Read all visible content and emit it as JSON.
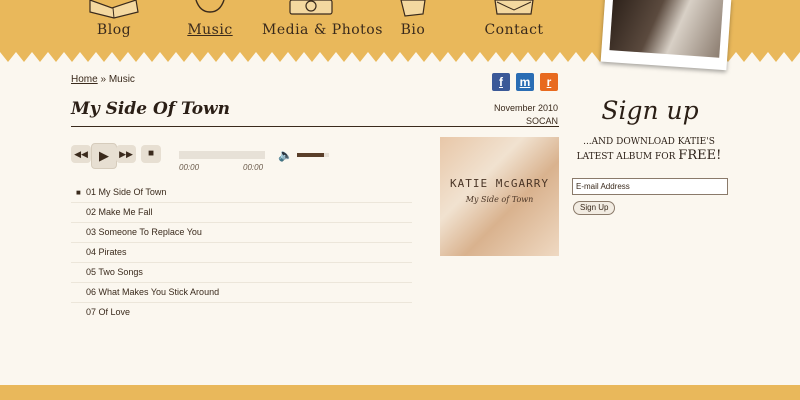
{
  "nav": {
    "items": [
      {
        "label": "Blog"
      },
      {
        "label": "Music"
      },
      {
        "label": "Media & Photos"
      },
      {
        "label": "Bio"
      },
      {
        "label": "Contact"
      }
    ],
    "active": "Music"
  },
  "breadcrumb": {
    "home": "Home",
    "separator": "»",
    "current": "Music"
  },
  "social": {
    "facebook": "f",
    "myspace": "m",
    "rss": "r"
  },
  "page": {
    "title": "My Side Of Town",
    "release_date": "November 2010",
    "label": "SOCAN"
  },
  "player": {
    "elapsed": "00:00",
    "duration": "00:00",
    "progress": 0,
    "volume": 0.85
  },
  "tracks": [
    "01 My Side Of Town",
    "02 Make Me Fall",
    "03 Someone To Replace You",
    "04 Pirates",
    "05 Two Songs",
    "06 What Makes You Stick Around",
    "07 Of Love"
  ],
  "album": {
    "artist": "KATIE McGARRY",
    "title": "My Side of Town"
  },
  "signup": {
    "title": "Sign up",
    "subtitle_line1": "...and download Katie's",
    "subtitle_line2": "latest album for",
    "subtitle_free": "FREE!",
    "email_placeholder": "E-mail Address",
    "button": "Sign Up"
  },
  "colors": {
    "header": "#e9b85b",
    "background": "#fbf7ef",
    "text": "#3a2a1c",
    "facebook": "#3b5998",
    "myspace": "#2a6db4",
    "rss": "#e86a1f"
  }
}
